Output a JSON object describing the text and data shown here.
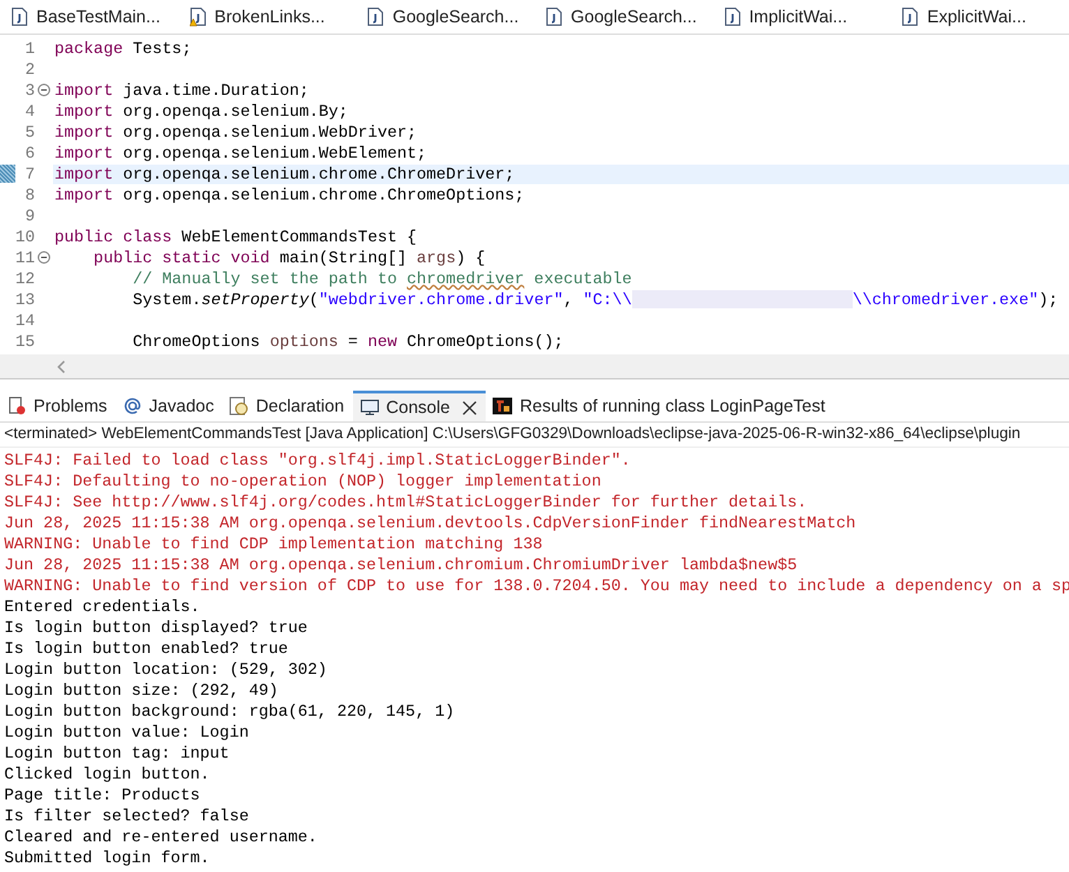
{
  "editor_tabs": [
    {
      "label": "BaseTestMain...",
      "kind": "java"
    },
    {
      "label": "BrokenLinks...",
      "kind": "warning"
    },
    {
      "label": "GoogleSearch...",
      "kind": "java"
    },
    {
      "label": "GoogleSearch...",
      "kind": "java"
    },
    {
      "label": "ImplicitWai...",
      "kind": "java"
    },
    {
      "label": "ExplicitWai...",
      "kind": "java"
    }
  ],
  "editor": {
    "lines": [
      {
        "number": "1",
        "foldable": false,
        "highlighted": false,
        "segments": [
          {
            "kind": "keyword",
            "text": "package"
          },
          {
            "kind": "plain",
            "text": " Tests;"
          }
        ]
      },
      {
        "number": "2",
        "foldable": false,
        "highlighted": false
      },
      {
        "number": "3",
        "foldable": true,
        "highlighted": false,
        "segments": [
          {
            "kind": "keyword",
            "text": "import"
          },
          {
            "kind": "plain",
            "text": " java.time.Duration;"
          }
        ]
      },
      {
        "number": "4",
        "foldable": false,
        "highlighted": false,
        "segments": [
          {
            "kind": "keyword",
            "text": "import"
          },
          {
            "kind": "plain",
            "text": " org.openqa.selenium.By;"
          }
        ]
      },
      {
        "number": "5",
        "foldable": false,
        "highlighted": false,
        "segments": [
          {
            "kind": "keyword",
            "text": "import"
          },
          {
            "kind": "plain",
            "text": " org.openqa.selenium.WebDriver;"
          }
        ]
      },
      {
        "number": "6",
        "foldable": false,
        "highlighted": false,
        "segments": [
          {
            "kind": "keyword",
            "text": "import"
          },
          {
            "kind": "plain",
            "text": " org.openqa.selenium.WebElement;"
          }
        ]
      },
      {
        "number": "7",
        "foldable": false,
        "highlighted": true,
        "segments": [
          {
            "kind": "keyword",
            "text": "import"
          },
          {
            "kind": "plain",
            "text": " org.openqa.selenium.chrome.ChromeDriver;"
          }
        ]
      },
      {
        "number": "8",
        "foldable": false,
        "highlighted": false,
        "segments": [
          {
            "kind": "keyword",
            "text": "import"
          },
          {
            "kind": "plain",
            "text": " org.openqa.selenium.chrome.ChromeOptions;"
          }
        ]
      },
      {
        "number": "9",
        "foldable": false,
        "highlighted": false
      },
      {
        "number": "10",
        "foldable": false,
        "highlighted": false,
        "segments": [
          {
            "kind": "keyword",
            "text": "public class"
          },
          {
            "kind": "plain",
            "text": " WebElementCommandsTest {"
          }
        ]
      },
      {
        "number": "11",
        "foldable": true,
        "highlighted": false,
        "segments": [
          {
            "kind": "keyword",
            "text": "    public static void"
          },
          {
            "kind": "plain",
            "text": " main(String[] "
          },
          {
            "kind": "variable",
            "text": "args"
          },
          {
            "kind": "plain",
            "text": ") {"
          }
        ]
      },
      {
        "number": "12",
        "foldable": false,
        "highlighted": false,
        "segments": [
          {
            "kind": "comment",
            "text": "        // Manually set the path to "
          },
          {
            "kind": "misspelled",
            "text": "chromedriver"
          },
          {
            "kind": "comment",
            "text": " executable"
          }
        ]
      },
      {
        "number": "13",
        "foldable": false,
        "highlighted": false,
        "segments": [
          {
            "kind": "plain",
            "text": "        System."
          },
          {
            "kind": "italic",
            "text": "setProperty"
          },
          {
            "kind": "plain",
            "text": "("
          },
          {
            "kind": "string",
            "text": "\"webdriver.chrome.driver\""
          },
          {
            "kind": "plain",
            "text": ", "
          },
          {
            "kind": "string",
            "text": "\"C:\\\\"
          },
          {
            "kind": "redacted"
          },
          {
            "kind": "string",
            "text": "\\\\chromedriver.exe\""
          },
          {
            "kind": "plain",
            "text": ");"
          }
        ]
      },
      {
        "number": "14",
        "foldable": false,
        "highlighted": false
      },
      {
        "number": "15",
        "foldable": false,
        "highlighted": false,
        "segments": [
          {
            "kind": "plain",
            "text": "        ChromeOptions "
          },
          {
            "kind": "variable",
            "text": "options"
          },
          {
            "kind": "plain",
            "text": " = "
          },
          {
            "kind": "keyword",
            "text": "new"
          },
          {
            "kind": "plain",
            "text": " ChromeOptions();"
          }
        ]
      }
    ]
  },
  "panel_tabs": [
    {
      "label": "Problems",
      "kind": "problems",
      "selected": false
    },
    {
      "label": "Javadoc",
      "kind": "javadoc",
      "selected": false
    },
    {
      "label": "Declaration",
      "kind": "declaration",
      "selected": false
    },
    {
      "label": "Console",
      "kind": "console",
      "selected": true
    },
    {
      "label": "Results of running class LoginPageTest",
      "kind": "results",
      "selected": false
    }
  ],
  "console": {
    "header": "<terminated> WebElementCommandsTest [Java Application] C:\\Users\\GFG0329\\Downloads\\eclipse-java-2025-06-R-win32-x86_64\\eclipse\\plugin",
    "lines": [
      {
        "kind": "stderr",
        "text": "SLF4J: Failed to load class \"org.slf4j.impl.StaticLoggerBinder\"."
      },
      {
        "kind": "stderr",
        "text": "SLF4J: Defaulting to no-operation (NOP) logger implementation"
      },
      {
        "kind": "stderr",
        "text": "SLF4J: See http://www.slf4j.org/codes.html#StaticLoggerBinder for further details."
      },
      {
        "kind": "stderr",
        "text": "Jun 28, 2025 11:15:38 AM org.openqa.selenium.devtools.CdpVersionFinder findNearestMatch"
      },
      {
        "kind": "stderr",
        "text": "WARNING: Unable to find CDP implementation matching 138"
      },
      {
        "kind": "stderr",
        "text": "Jun 28, 2025 11:15:38 AM org.openqa.selenium.chromium.ChromiumDriver lambda$new$5"
      },
      {
        "kind": "stderr",
        "text": "WARNING: Unable to find version of CDP to use for 138.0.7204.50. You may need to include a dependency on a sp"
      },
      {
        "kind": "stdout",
        "text": "Entered credentials."
      },
      {
        "kind": "stdout",
        "text": "Is login button displayed? true"
      },
      {
        "kind": "stdout",
        "text": "Is login button enabled? true"
      },
      {
        "kind": "stdout",
        "text": "Login button location: (529, 302)"
      },
      {
        "kind": "stdout",
        "text": "Login button size: (292, 49)"
      },
      {
        "kind": "stdout",
        "text": "Login button background: rgba(61, 220, 145, 1)"
      },
      {
        "kind": "stdout",
        "text": "Login button value: Login"
      },
      {
        "kind": "stdout",
        "text": "Login button tag: input"
      },
      {
        "kind": "stdout",
        "text": "Clicked login button."
      },
      {
        "kind": "stdout",
        "text": "Page title: Products"
      },
      {
        "kind": "stdout",
        "text": "Is filter selected? false"
      },
      {
        "kind": "stdout",
        "text": "Cleared and re-entered username."
      },
      {
        "kind": "stdout",
        "text": "Submitted login form."
      }
    ]
  }
}
